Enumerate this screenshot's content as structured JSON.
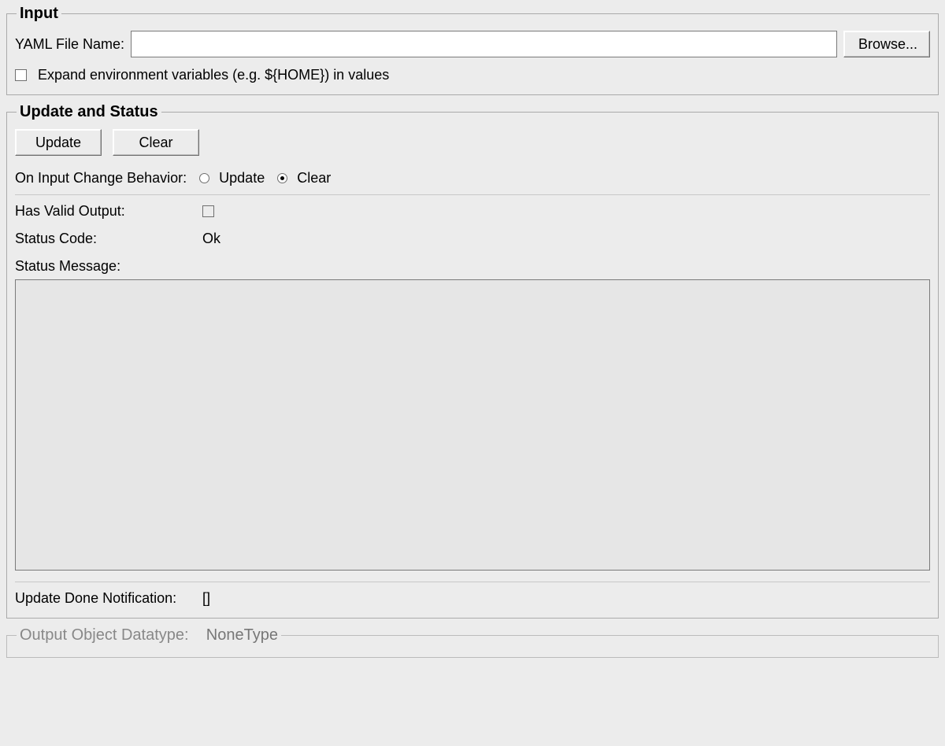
{
  "input": {
    "legend": "Input",
    "yaml_file_label": "YAML File Name:",
    "yaml_file_value": "",
    "browse_label": "Browse...",
    "expand_env_label": "Expand environment variables (e.g. ${HOME}) in values",
    "expand_env_checked": false
  },
  "update_status": {
    "legend": "Update and Status",
    "update_btn": "Update",
    "clear_btn": "Clear",
    "on_change_label": "On Input Change Behavior:",
    "radio_update": "Update",
    "radio_clear": "Clear",
    "radio_selected": "clear",
    "has_valid_output_label": "Has Valid Output:",
    "has_valid_output_checked": false,
    "status_code_label": "Status Code:",
    "status_code_value": "Ok",
    "status_message_label": "Status Message:",
    "status_message_value": "",
    "update_done_label": "Update Done Notification:",
    "update_done_value": "[]"
  },
  "output": {
    "legend": "Output Object Datatype:",
    "value": "NoneType"
  }
}
